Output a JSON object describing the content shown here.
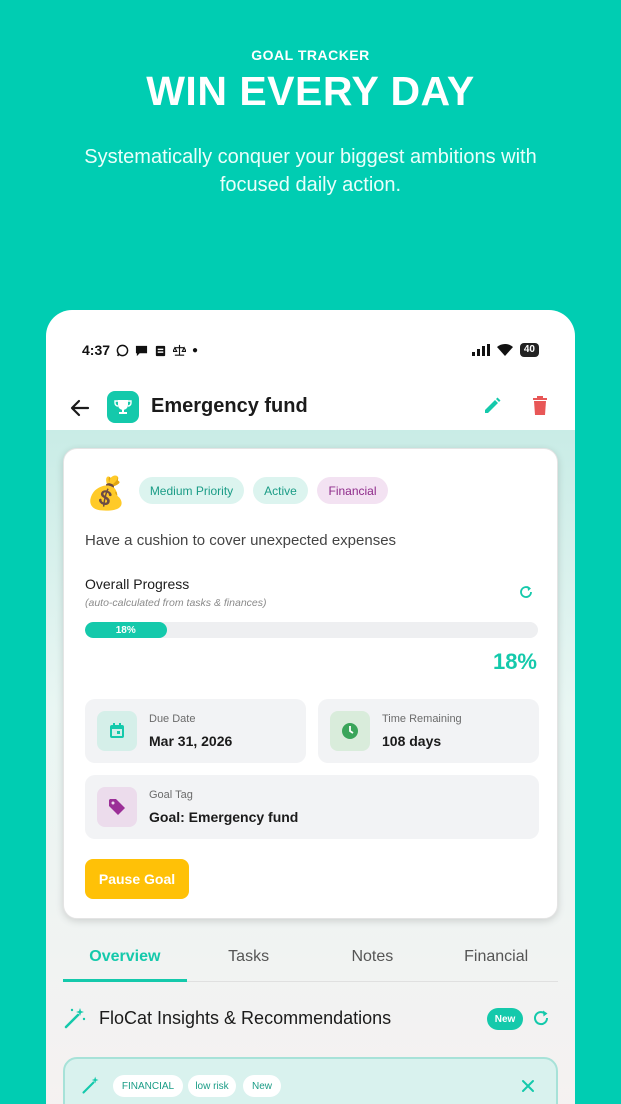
{
  "promo": {
    "eyebrow": "GOAL TRACKER",
    "title": "WIN EVERY DAY",
    "subtitle": "Systematically conquer your biggest ambitions with focused daily action."
  },
  "status_bar": {
    "time": "4:37",
    "battery": "40",
    "icons": [
      "whatsapp-icon",
      "chat-icon",
      "clipboard-icon",
      "scale-icon",
      "dot-icon",
      "signal-icon",
      "wifi-icon",
      "battery-icon"
    ]
  },
  "app_bar": {
    "title": "Emergency fund",
    "icons": [
      "back-arrow-icon",
      "trophy-icon",
      "edit-icon",
      "delete-icon"
    ]
  },
  "goal": {
    "emoji": "💰",
    "chips": {
      "priority": "Medium Priority",
      "status": "Active",
      "category": "Financial"
    },
    "description": "Have a cushion to cover unexpected expenses",
    "progress": {
      "title": "Overall Progress",
      "note": "(auto-calculated from tasks & finances)",
      "value": 0.18,
      "bar_label": "18%",
      "display": "18%"
    },
    "due_date": {
      "label": "Due Date",
      "value": "Mar 31, 2026"
    },
    "time_remaining": {
      "label": "Time Remaining",
      "value": "108 days"
    },
    "goal_tag": {
      "label": "Goal Tag",
      "value": "Goal: Emergency fund"
    },
    "pause_label": "Pause Goal"
  },
  "tabs": [
    {
      "label": "Overview",
      "active": true
    },
    {
      "label": "Tasks",
      "active": false
    },
    {
      "label": "Notes",
      "active": false
    },
    {
      "label": "Financial",
      "active": false
    }
  ],
  "insights": {
    "title": "FloCat Insights & Recommendations",
    "badge": "New",
    "card_chips": [
      "FINANCIAL",
      "low risk",
      "New"
    ]
  },
  "colors": {
    "background": "#00cdb2",
    "accent": "#14c9ab",
    "warning": "#ffc107",
    "danger": "#e85757",
    "category": "#8e2a8a"
  }
}
